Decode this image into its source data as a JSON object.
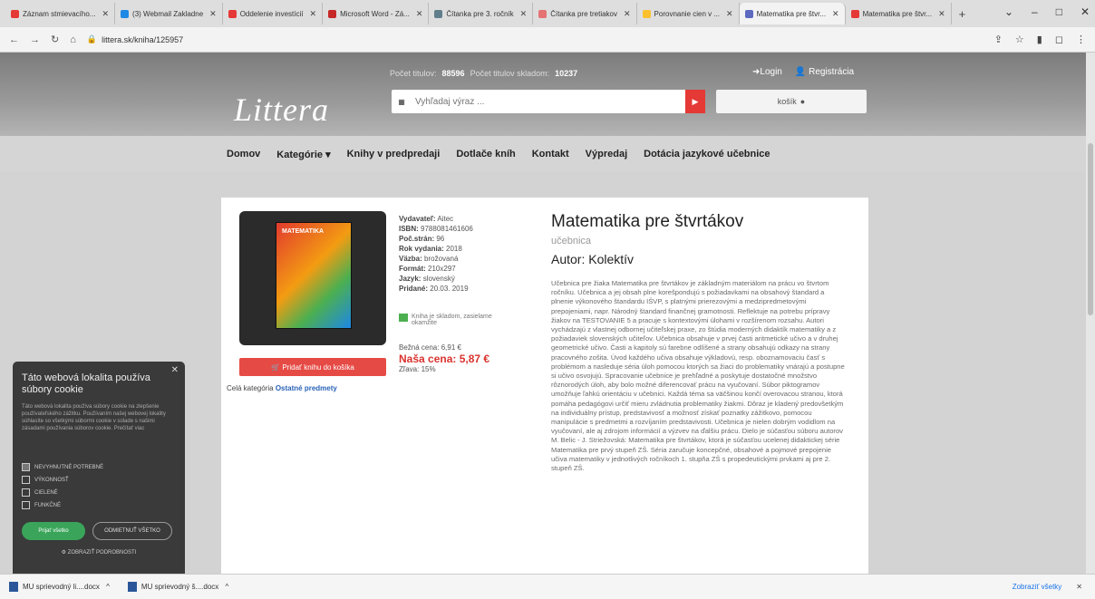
{
  "tabs": [
    {
      "label": "Záznam stmievacího...",
      "color": "#e53935"
    },
    {
      "label": "(3) Webmail Zakladne",
      "color": "#1e88e5"
    },
    {
      "label": "Oddelenie investícií",
      "color": "#e53935"
    },
    {
      "label": "Microsoft Word - Zá...",
      "color": "#c62828"
    },
    {
      "label": "Čítanka pre 3. ročník",
      "color": "#607d8b"
    },
    {
      "label": "Čítanka pre tretiakov",
      "color": "#e57373"
    },
    {
      "label": "Porovnanie cien v ...",
      "color": "#fbc02d"
    },
    {
      "label": "Matematika pre štvr...",
      "color": "#5c6bc0",
      "active": true
    },
    {
      "label": "Matematika pre štvr...",
      "color": "#e53935"
    }
  ],
  "browser": {
    "url": "littera.sk/kniha/125957"
  },
  "header": {
    "counter_label1": "Počet titulov:",
    "counter_value1": "88596",
    "counter_label2": "Počet titulov skladom:",
    "counter_value2": "10237",
    "login": "Login",
    "register": "Registrácia",
    "logo": "Littera",
    "search_placeholder": "Vyhľadaj výraz ...",
    "search_prefix": "Vyhľadaj",
    "cart": "košík"
  },
  "nav": [
    "Domov",
    "Kategórie ▾",
    "Knihy v predpredaji",
    "Dotlače kníh",
    "Kontakt",
    "Výpredaj",
    "Dotácia jazykové učebnice"
  ],
  "product": {
    "cover_title": "MATEMATIKA",
    "publisher_label": "Vydavateľ:",
    "publisher": "Aitec",
    "isbn_label": "ISBN:",
    "isbn": "9788081461606",
    "pages_label": "Poč.strán:",
    "pages": "96",
    "year_label": "Rok vydania:",
    "year": "2018",
    "binding_label": "Väzba:",
    "binding": "brožovaná",
    "format_label": "Formát:",
    "format": "210x297",
    "lang_label": "Jazyk:",
    "lang": "slovenský",
    "added_label": "Pridané:",
    "added": "20.03. 2019",
    "stock": "Kniha je skladom, zasielame okamžite",
    "old_price": "Bežná cena: 6,91 €",
    "new_price": "Naša cena: 5,87 €",
    "discount": "Zľava: 15%",
    "buy": "Pridať knihu do košíka",
    "category_prefix": "Celá kategória",
    "category": "Ostatné predmety",
    "title": "Matematika pre štvrtákov",
    "subtitle": "učebnica",
    "author": "Autor: Kolektív",
    "description": "Učebnica pre žiaka Matematika pre štvrtákov je základným materiálom na prácu vo štvrtom ročníku. Učebnica a jej obsah plne korešpondujú s požiadavkami na obsahový štandard a plnenie výkonového štandardu IŠVP, s platnými prierezovými a medzipredmetovými prepojeniami, napr. Národný štandard finančnej gramotnosti. Reflektuje na potrebu prípravy žiakov na TESTOVANIE 5 a pracuje s kontextovými úlohami v rozšírenom rozsahu. Autori vychádzajú z vlastnej odbornej učiteľskej praxe, zo štúdia moderných didaktík matematiky a z požiadaviek slovenských učiteľov. Učebnica obsahuje v prvej časti aritmetické učivo a v druhej geometrické učivo. Časti a kapitoly sú farebne odlíšené a strany obsahujú odkazy na strany pracovného zošita. Úvod každého učiva obsahuje výkladovú, resp. oboznamovaciu časť s problémom a nasleduje séria úloh pomocou ktorých sa žiaci do problematiky vnárajú a postupne si učivo osvojujú. Spracovanie učebnice je prehľadné a poskytuje dostatočné množstvo rôznorodých úloh, aby bolo možné diferencovať prácu na vyučovaní. Súbor piktogramov umožňuje ľahkú orientáciu v učebnici. Každá téma sa väčšinou končí overovacou stranou, ktorá pomáha pedagógovi určiť mieru zvládnutia problematiky žiakmi. Dôraz je kladený predovšetkým na individuálny prístup, predstavivosť a možnosť získať poznatky zážitkovo, pomocou manipulácie s predmetmi a rozvíjaním predstavivosti. Učebnica je nielen dobrým vodidlom na vyučovaní, ale aj zdrojom informácií a výzvev na ďalšiu prácu. Dielo je súčasťou súboru autorov M. Belic - J. Striežovská: Matematika pre štvrtákov, ktorá je súčasťou ucelenej didaktickej série Matematika pre prvý stupeň ZŠ. Séria zaručuje koncepčné, obsahové a pojmové prepojenie učiva matematiky v jednotlivých ročníkoch 1. stupňa ZŠ s propedeutickými prvkami aj pre 2. stupeň ZŠ."
  },
  "cookie": {
    "title": "Táto webová lokalita používa súbory cookie",
    "text": "Táto webová lokalita používa súbory cookie na zlepšenie používateľského zážitku. Používaním našej webovej lokality súhlasíte so všetkými súbormi cookie v súlade s našimi zásadami používania súborov cookie. Prečítať viac",
    "options": [
      "NEVYHNUTNÉ POTREBNÉ",
      "VÝKONNOSŤ",
      "CIELENÉ",
      "FUNKČNÉ"
    ],
    "accept": "Prijať všetko",
    "decline": "ODMIETNUŤ VŠETKO",
    "settings": "ZOBRAZIŤ PODROBNOSTI"
  },
  "downloads": {
    "items": [
      "MU sprievodný li....docx",
      "MU sprievodný š....docx"
    ],
    "show_all": "Zobraziť všetky"
  }
}
